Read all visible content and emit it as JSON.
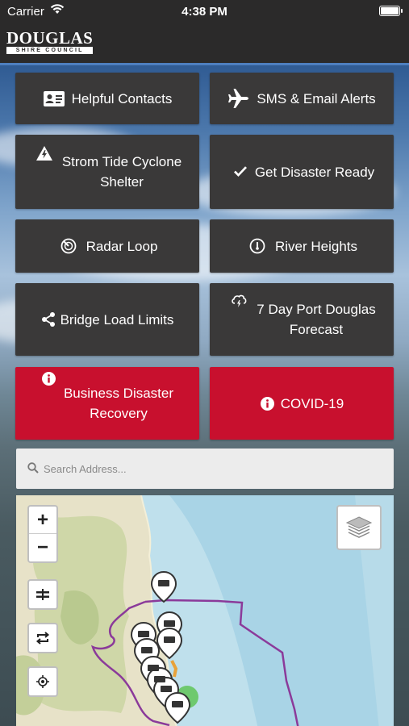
{
  "status": {
    "carrier": "Carrier",
    "time": "4:38 PM"
  },
  "header": {
    "logo_main": "DOUGLAS",
    "logo_sub": "SHIRE COUNCIL"
  },
  "buttons": {
    "helpful_contacts": "Helpful Contacts",
    "sms_alerts": "SMS & Email Alerts",
    "storm_line1": "Strom Tide Cyclone",
    "storm_line2": "Shelter",
    "disaster_ready": "Get Disaster Ready",
    "radar_loop": "Radar Loop",
    "river_heights": "River Heights",
    "bridge_load": "Bridge Load Limits",
    "forecast_line1": "7 Day Port Douglas",
    "forecast_line2": "Forecast",
    "business_line1": "Business Disaster",
    "business_line2": "Recovery",
    "covid": "COVID-19"
  },
  "search": {
    "placeholder": "Search Address..."
  },
  "map": {
    "zoom_in": "+",
    "zoom_out": "−"
  },
  "colors": {
    "button_dark": "#3a3939",
    "button_red": "#c8102e",
    "boundary": "#8b3a9a",
    "header": "#2b2a2a"
  }
}
